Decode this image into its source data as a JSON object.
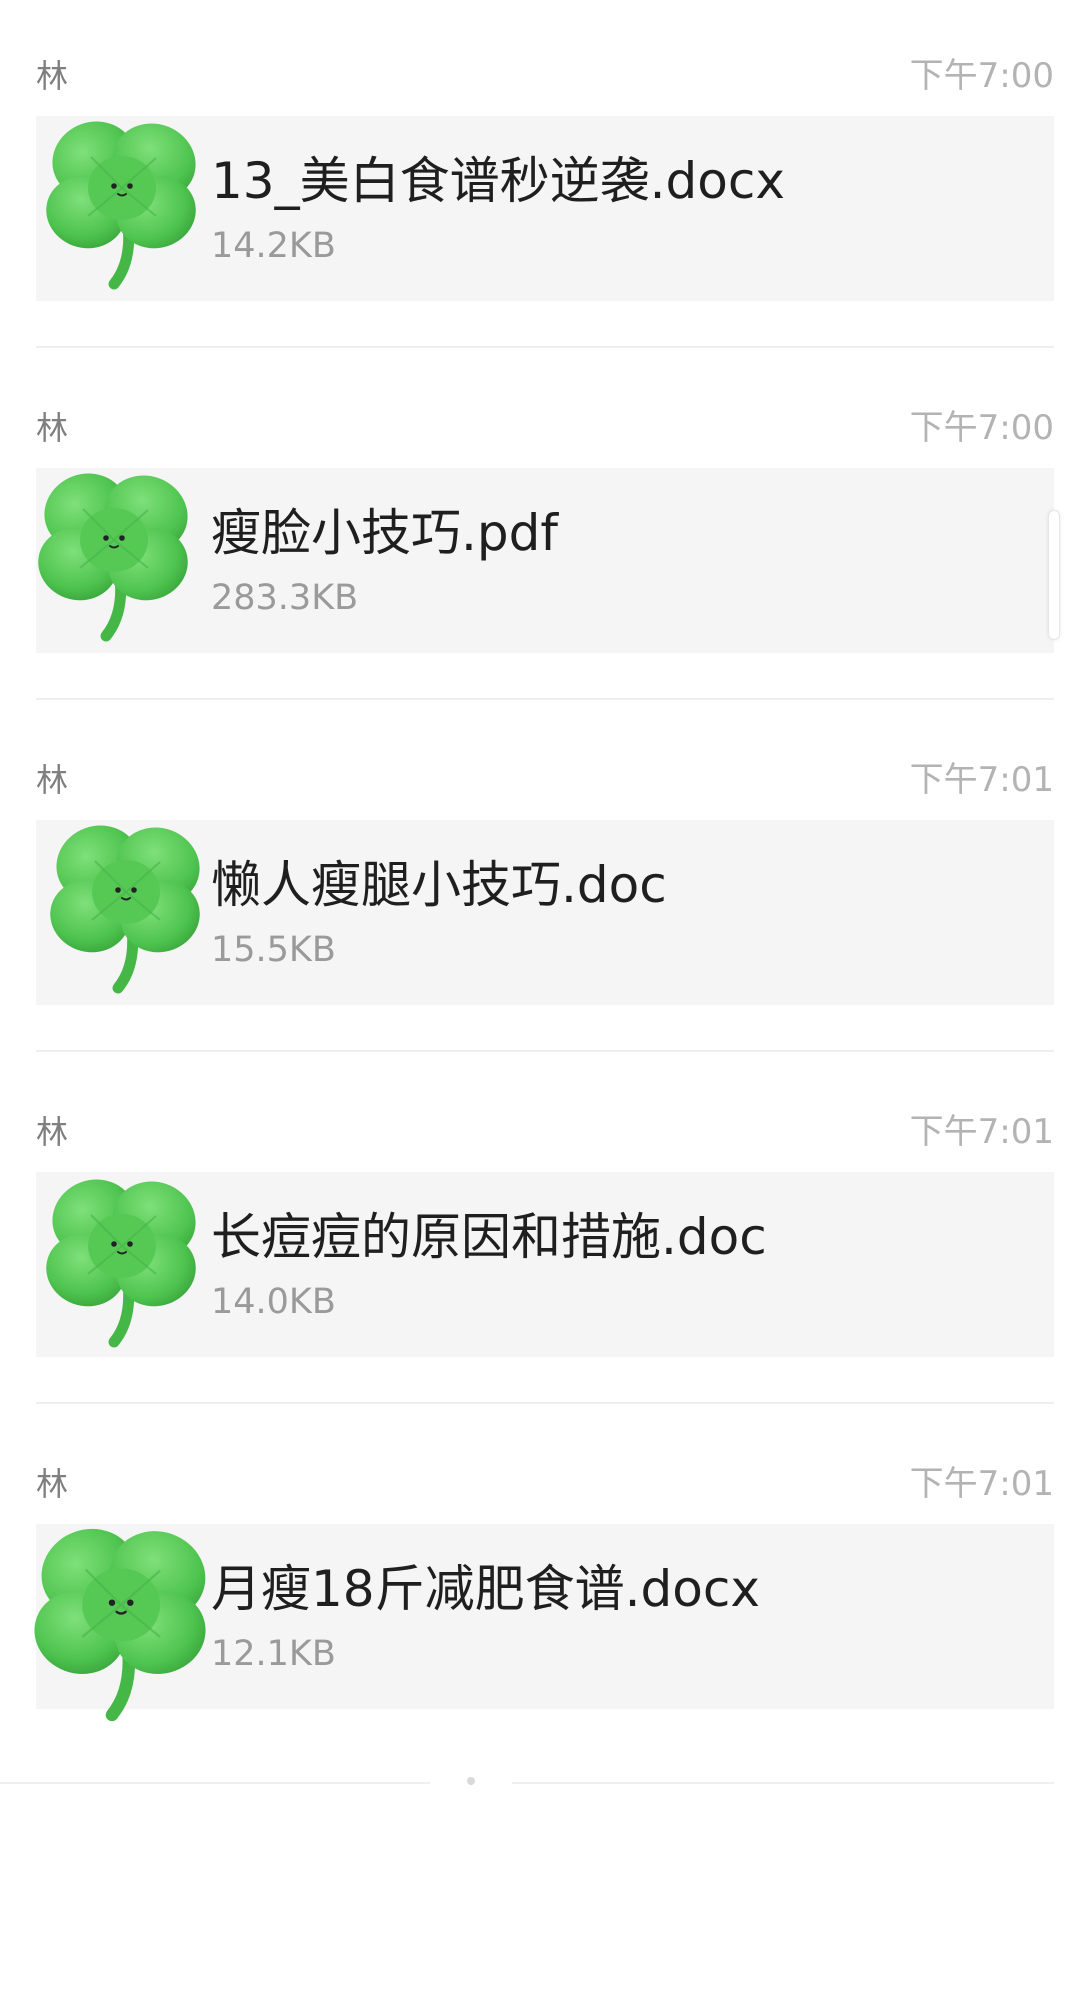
{
  "messages": [
    {
      "sender": "林",
      "time": "下午7:00",
      "file_name": "13_美白食谱秒逆袭.docx",
      "file_size": "14.2KB",
      "icon": "four-leaf-clover"
    },
    {
      "sender": "林",
      "time": "下午7:00",
      "file_name": "瘦脸小技巧.pdf",
      "file_size": "283.3KB",
      "icon": "four-leaf-clover"
    },
    {
      "sender": "林",
      "time": "下午7:01",
      "file_name": "懒人瘦腿小技巧.doc",
      "file_size": "15.5KB",
      "icon": "four-leaf-clover"
    },
    {
      "sender": "林",
      "time": "下午7:01",
      "file_name": "长痘痘的原因和措施.doc",
      "file_size": "14.0KB",
      "icon": "four-leaf-clover"
    },
    {
      "sender": "林",
      "time": "下午7:01",
      "file_name": "月瘦18斤减肥食谱.docx",
      "file_size": "12.1KB",
      "icon": "four-leaf-clover"
    }
  ],
  "colors": {
    "clover_green": "#5cd05c",
    "card_background": "#f5f5f5"
  }
}
